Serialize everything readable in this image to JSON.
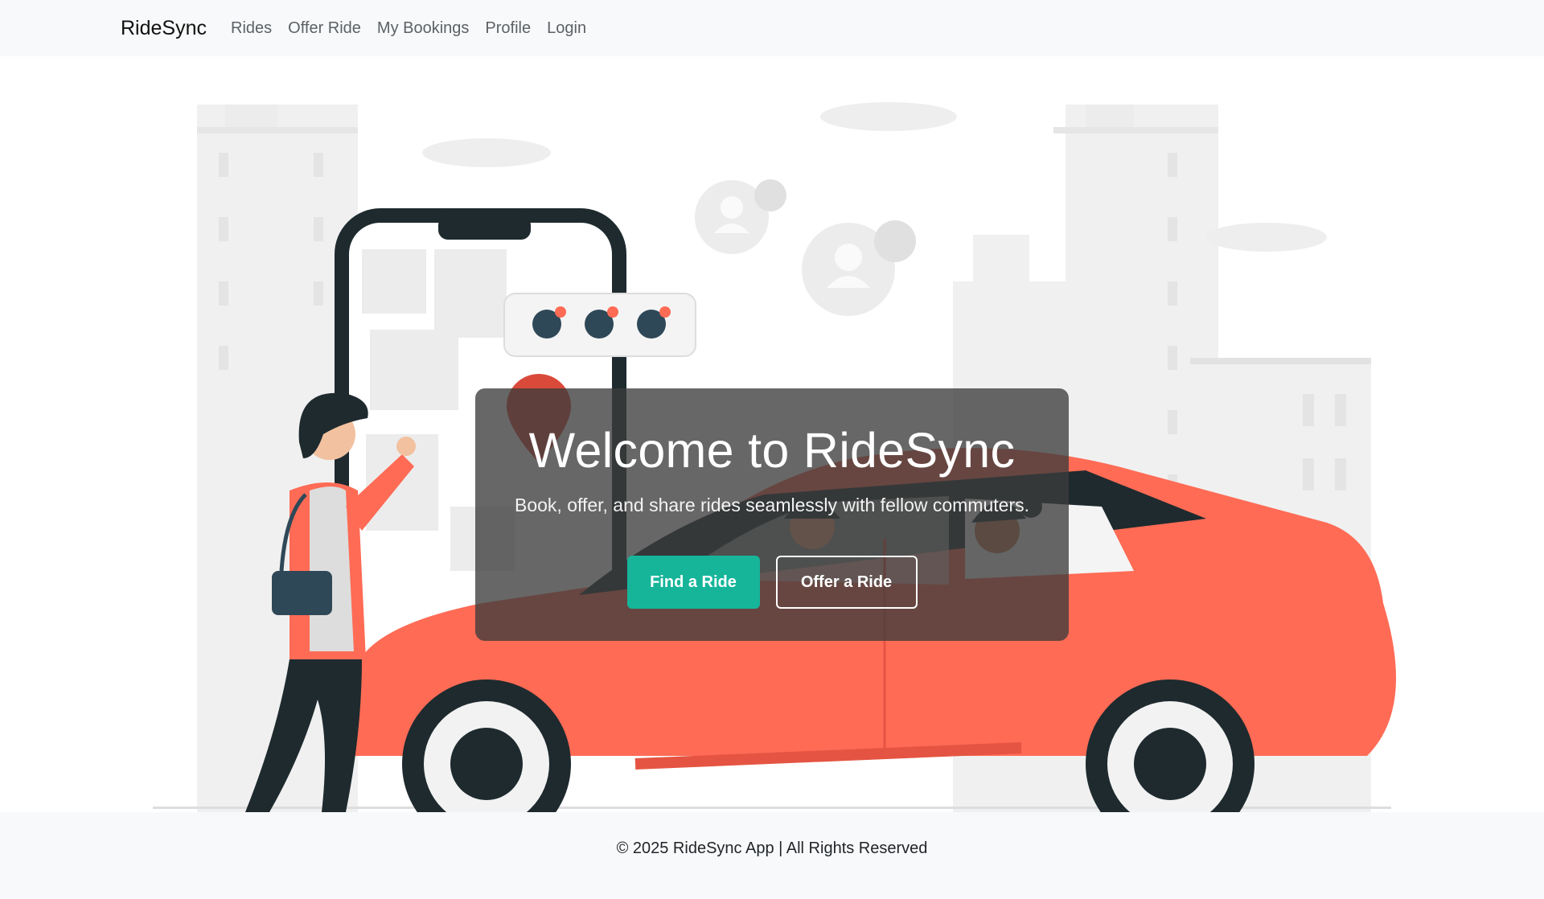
{
  "navbar": {
    "brand": "RideSync",
    "links": [
      "Rides",
      "Offer Ride",
      "My Bookings",
      "Profile",
      "Login"
    ]
  },
  "hero": {
    "title": "Welcome to RideSync",
    "subtitle": "Book, offer, and share rides seamlessly with fellow commuters.",
    "primary_button": "Find a Ride",
    "secondary_button": "Offer a Ride"
  },
  "footer": {
    "text": "© 2025 RideSync App | All Rights Reserved"
  },
  "colors": {
    "accent": "#16b59a",
    "car": "#ff6b55",
    "nav_bg": "#f8f9fa"
  }
}
